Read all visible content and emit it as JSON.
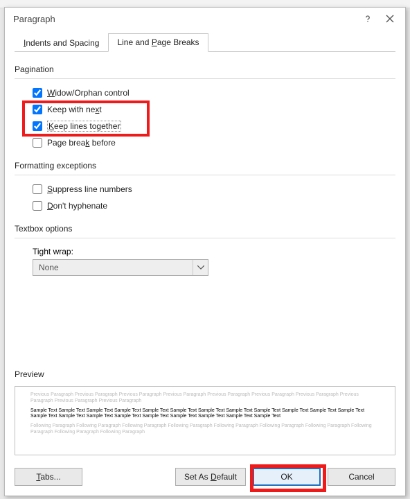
{
  "dialog": {
    "title": "Paragraph"
  },
  "tabs": {
    "indents": "Indents and Spacing",
    "breaks": "Line and Page Breaks"
  },
  "pagination": {
    "heading": "Pagination",
    "widow": "Widow/Orphan control",
    "keepNext": "Keep with next",
    "keepLines": "Keep lines together",
    "pageBreak": "Page break before"
  },
  "formatting": {
    "heading": "Formatting exceptions",
    "suppress": "Suppress line numbers",
    "dontHyphen": "Don't hyphenate"
  },
  "textbox": {
    "heading": "Textbox options",
    "tightWrapLabel": "Tight wrap:",
    "tightWrapValue": "None"
  },
  "preview": {
    "heading": "Preview",
    "prev": "Previous Paragraph Previous Paragraph Previous Paragraph Previous Paragraph Previous Paragraph Previous Paragraph Previous Paragraph Previous Paragraph Previous Paragraph Previous Paragraph",
    "sample": "Sample Text Sample Text Sample Text Sample Text Sample Text Sample Text Sample Text Sample Text Sample Text Sample Text Sample Text Sample Text Sample Text Sample Text Sample Text Sample Text Sample Text Sample Text Sample Text Sample Text Sample Text",
    "next": "Following Paragraph Following Paragraph Following Paragraph Following Paragraph Following Paragraph Following Paragraph Following Paragraph Following Paragraph Following Paragraph Following Paragraph"
  },
  "buttons": {
    "tabs": "Tabs...",
    "setDefault": "Set As Default",
    "ok": "OK",
    "cancel": "Cancel"
  }
}
